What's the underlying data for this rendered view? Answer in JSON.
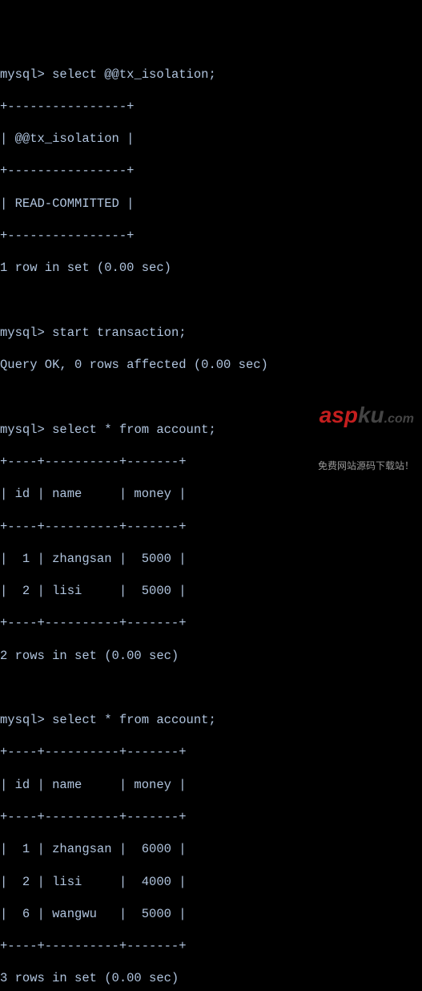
{
  "prompt": "mysql>",
  "cmd1": "select @@tx_isolation;",
  "tbl1": {
    "border_top": "+----------------+",
    "header": "| @@tx_isolation |",
    "border_mid": "+----------------+",
    "row1": "| READ-COMMITTED |",
    "border_bot": "+----------------+"
  },
  "result1": "1 row in set (0.00 sec)",
  "cmd2": "start transaction;",
  "result2": "Query OK, 0 rows affected (0.00 sec)",
  "cmd3": "select * from account;",
  "tbl2": {
    "border_top": "+----+----------+-------+",
    "header": "| id | name     | money |",
    "border_mid": "+----+----------+-------+",
    "row1": "|  1 | zhangsan |  5000 |",
    "row2": "|  2 | lisi     |  5000 |",
    "border_bot": "+----+----------+-------+"
  },
  "result3": "2 rows in set (0.00 sec)",
  "cmd4": "select * from account;",
  "tbl3": {
    "border_top": "+----+----------+-------+",
    "header": "| id | name     | money |",
    "border_mid": "+----+----------+-------+",
    "row1": "|  1 | zhangsan |  6000 |",
    "row2": "|  2 | lisi     |  4000 |",
    "row3": "|  6 | wangwu   |  5000 |",
    "border_bot": "+----+----------+-------+"
  },
  "result4": "3 rows in set (0.00 sec)",
  "watermark": {
    "main_a": "a",
    "main_sp": "sp",
    "main_ku": "ku",
    "main_com": ".com",
    "sub": "免费网站源码下载站！"
  },
  "chart_data": {
    "type": "table",
    "tables": [
      {
        "title": "@@tx_isolation",
        "columns": [
          "@@tx_isolation"
        ],
        "rows": [
          [
            "READ-COMMITTED"
          ]
        ]
      },
      {
        "title": "account (before)",
        "columns": [
          "id",
          "name",
          "money"
        ],
        "rows": [
          [
            1,
            "zhangsan",
            5000
          ],
          [
            2,
            "lisi",
            5000
          ]
        ]
      },
      {
        "title": "account (after)",
        "columns": [
          "id",
          "name",
          "money"
        ],
        "rows": [
          [
            1,
            "zhangsan",
            6000
          ],
          [
            2,
            "lisi",
            4000
          ],
          [
            6,
            "wangwu",
            5000
          ]
        ]
      }
    ]
  }
}
